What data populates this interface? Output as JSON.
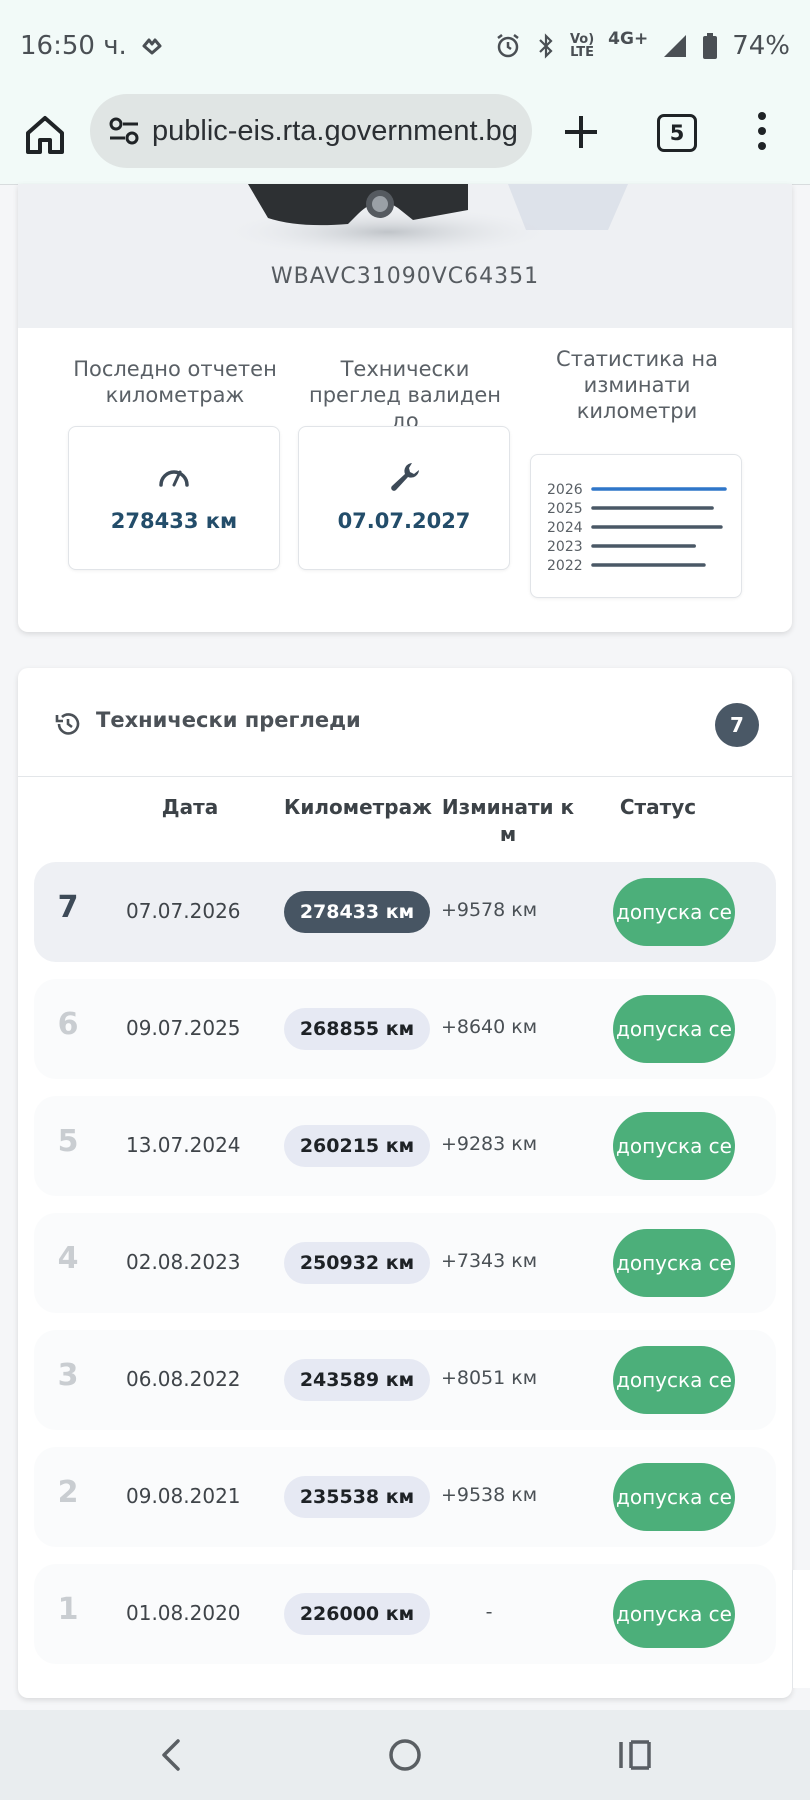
{
  "status_bar": {
    "time": "16:50 ч.",
    "volte_line1": "Vo)",
    "volte_line2": "LTE",
    "network": "4G+",
    "battery": "74%"
  },
  "browser": {
    "url": "public-eis.rta.government.bg",
    "tab_count": "5"
  },
  "vehicle": {
    "vin": "WBAVC31090VC64351",
    "stats": [
      {
        "title": "Последно отчетен километраж",
        "value": "278433 км",
        "icon": "speedometer-icon"
      },
      {
        "title": "Технически преглед валиден до",
        "value": "07.07.2027",
        "icon": "wrench-icon"
      },
      {
        "title": "Статистика на изминати километри",
        "icon": "mini-chart"
      }
    ],
    "mini_chart": {
      "type": "bar",
      "categories": [
        "2026",
        "2025",
        "2024",
        "2023",
        "2022"
      ],
      "values": [
        9578,
        8640,
        9283,
        7343,
        8051
      ],
      "highlight_color": "#2f76c9",
      "bar_color": "#4a5866"
    }
  },
  "inspections": {
    "title": "Технически прегледи",
    "count": "7",
    "headers": {
      "date": "Дата",
      "mileage": "Километраж",
      "traveled": "Изминати к м",
      "status": "Статус"
    },
    "rows": [
      {
        "num": "7",
        "date": "07.07.2026",
        "km": "278433 км",
        "diff": "+9578 км",
        "status": "допуска се",
        "active": true
      },
      {
        "num": "6",
        "date": "09.07.2025",
        "km": "268855 км",
        "diff": "+8640 км",
        "status": "допуска се",
        "active": false
      },
      {
        "num": "5",
        "date": "13.07.2024",
        "km": "260215 км",
        "diff": "+9283 км",
        "status": "допуска се",
        "active": false
      },
      {
        "num": "4",
        "date": "02.08.2023",
        "km": "250932 км",
        "diff": "+7343 км",
        "status": "допуска се",
        "active": false
      },
      {
        "num": "3",
        "date": "06.08.2022",
        "km": "243589 км",
        "diff": "+8051 км",
        "status": "допуска се",
        "active": false
      },
      {
        "num": "2",
        "date": "09.08.2021",
        "km": "235538 км",
        "diff": "+9538 км",
        "status": "допуска се",
        "active": false
      },
      {
        "num": "1",
        "date": "01.08.2020",
        "km": "226000 км",
        "diff": "-",
        "status": "допуска се",
        "active": false
      }
    ]
  },
  "colors": {
    "accent": "#234d6a",
    "status_green": "#4caf7a",
    "badge_dark": "#4a5866"
  }
}
